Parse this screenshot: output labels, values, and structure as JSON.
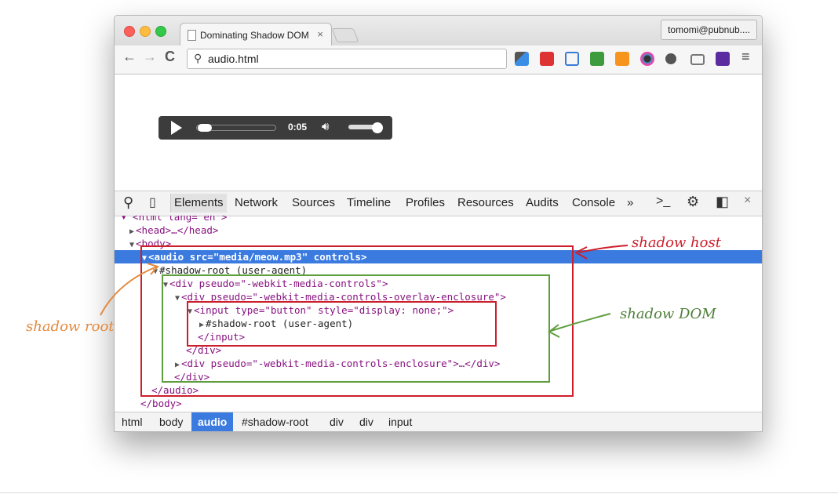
{
  "browser": {
    "tab_title": "Dominating Shadow DOM",
    "tab_close": "×",
    "profile": "tomomi@pubnub....",
    "url": "audio.html",
    "nav": {
      "back": "←",
      "forward": "→",
      "reload": "C"
    },
    "menu_glyph": "≡"
  },
  "player": {
    "time": "0:05"
  },
  "devtools": {
    "tabs": [
      "Elements",
      "Network",
      "Sources",
      "Timeline",
      "Profiles",
      "Resources",
      "Audits",
      "Console"
    ],
    "more": "»",
    "close": "×",
    "dom": {
      "head": "<head>…</head>",
      "body_open": "<body>",
      "audio_open": "<audio src=\"media/meow.mp3\" controls>",
      "audio_src": "media/meow.mp3",
      "shadow_root_1": "#shadow-root (user-agent)",
      "div_media_controls": "<div pseudo=\"-webkit-media-controls\">",
      "div_overlay": "<div pseudo=\"-webkit-media-controls-overlay-enclosure\">",
      "input_open": "<input type=\"button\" style=\"display: none;\">",
      "shadow_root_2": "#shadow-root (user-agent)",
      "input_close": "</input>",
      "div_close_1": "</div>",
      "div_enclosure": "<div pseudo=\"-webkit-media-controls-enclosure\">…</div>",
      "div_close_2": "</div>",
      "audio_close": "</audio>",
      "body_close": "</body>"
    },
    "breadcrumbs": [
      "html",
      "body",
      "audio",
      "#shadow-root",
      "div",
      "div",
      "input"
    ],
    "breadcrumb_active": "audio"
  },
  "annotations": {
    "shadow_host": "shadow host",
    "shadow_dom": "shadow DOM",
    "shadow_root": "shadow root"
  },
  "colors": {
    "host": "#cc1f2b",
    "dom": "#5f9e3f",
    "root": "#e38a3e",
    "selection": "#3b7be0"
  }
}
